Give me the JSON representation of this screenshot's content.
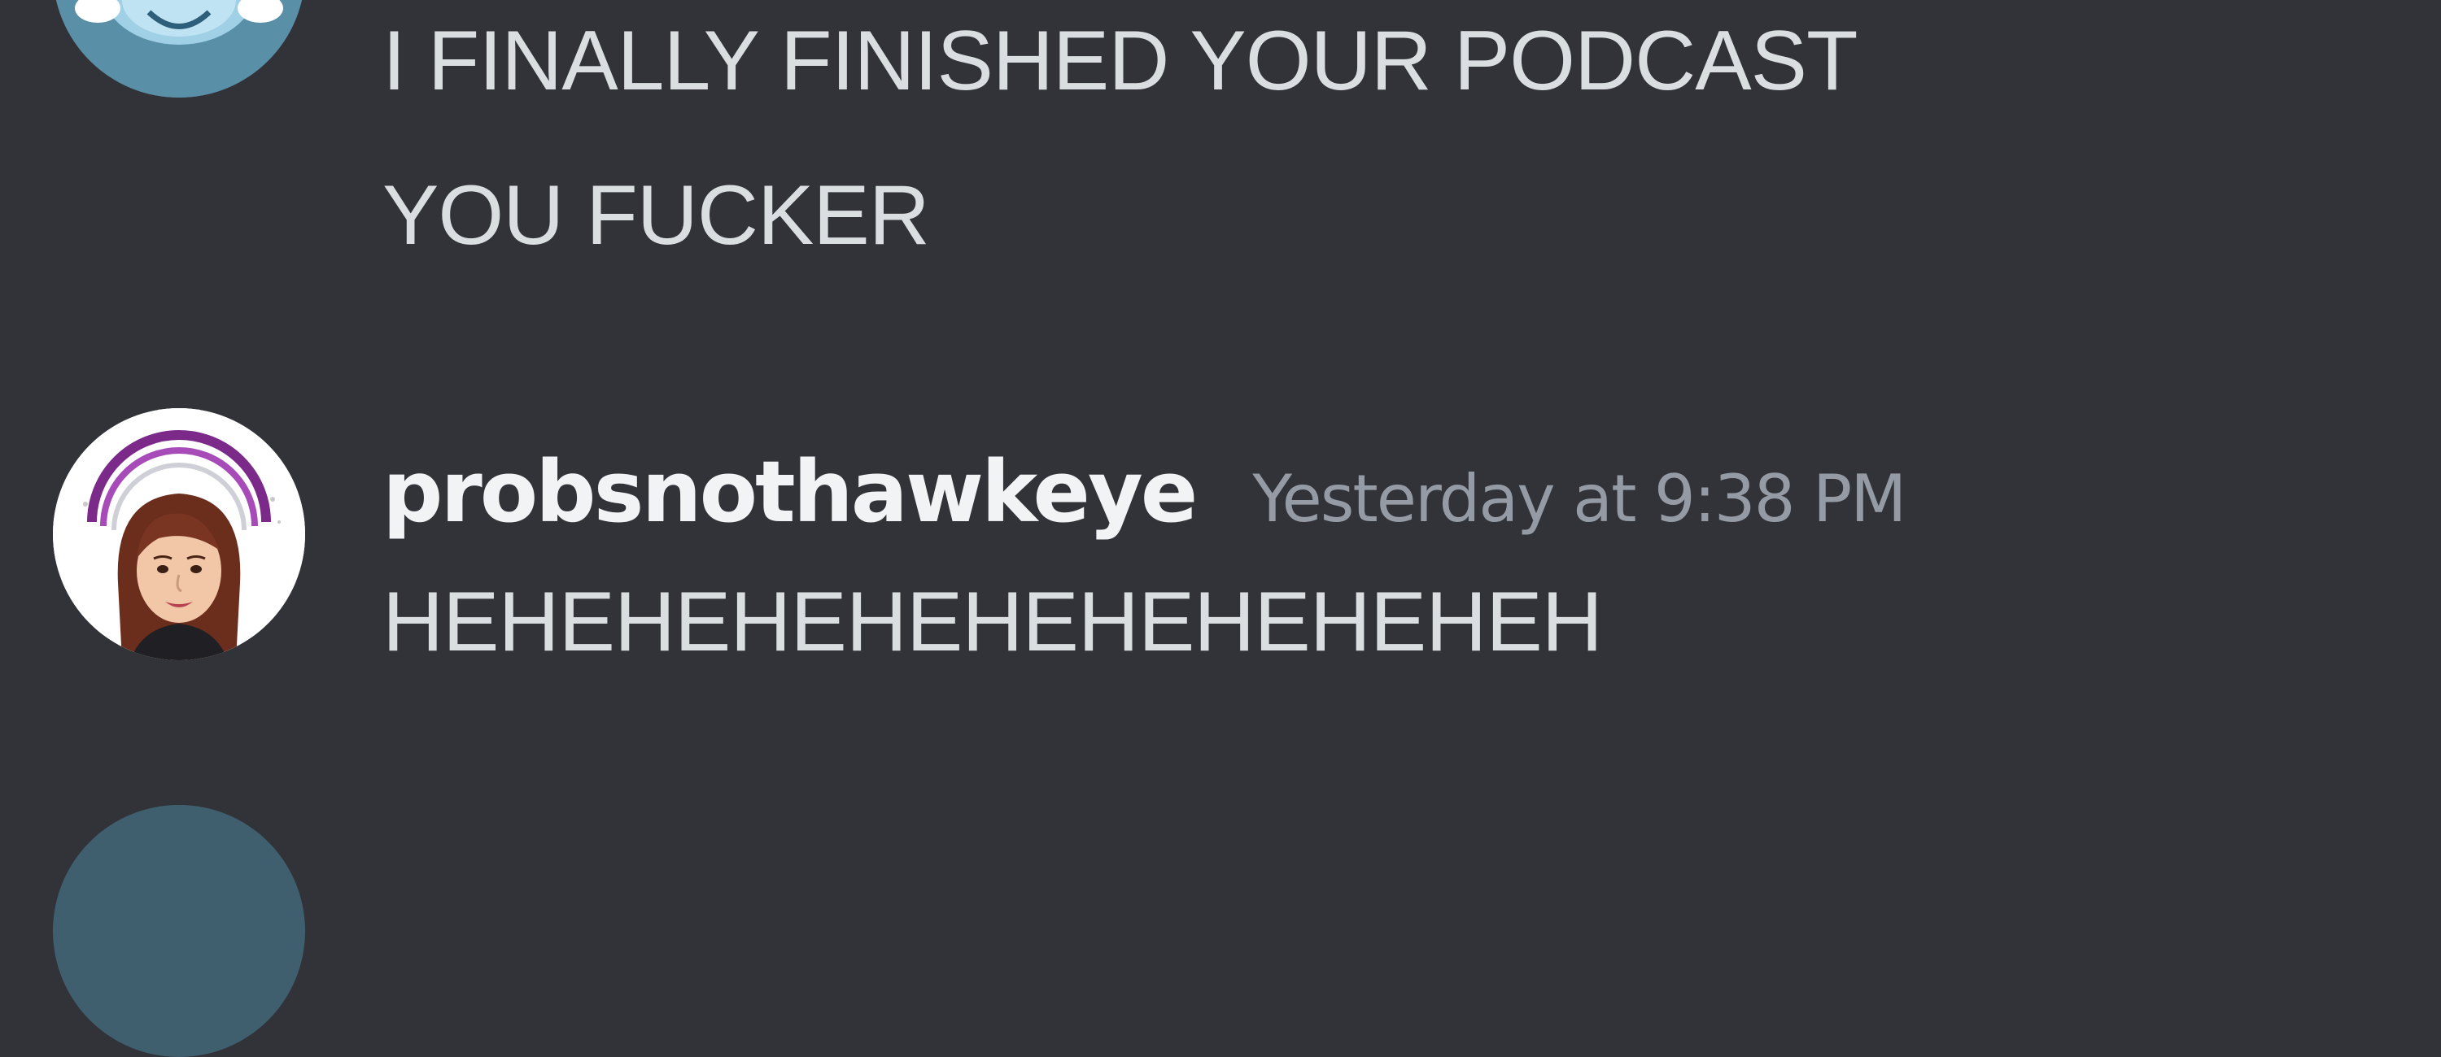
{
  "colors": {
    "background": "#313338",
    "message_text": "#dbdee1",
    "username": "#f2f3f5",
    "timestamp": "#949ba4",
    "avatar1_bg": "#5a8fa8",
    "avatar2_ring": "#7b2a8a"
  },
  "messages": [
    {
      "avatar_icon": "blue-cartoon-avatar",
      "lines": [
        "I FINALLY FINISHED YOUR PODCAST",
        "YOU FUCKER"
      ]
    },
    {
      "avatar_icon": "bitmoji-woman-avatar",
      "username": "probsnothawkeye",
      "timestamp": "Yesterday at 9:38 PM",
      "lines": [
        "HEHEHEHEHEHEHEHEHEHEH"
      ]
    }
  ]
}
